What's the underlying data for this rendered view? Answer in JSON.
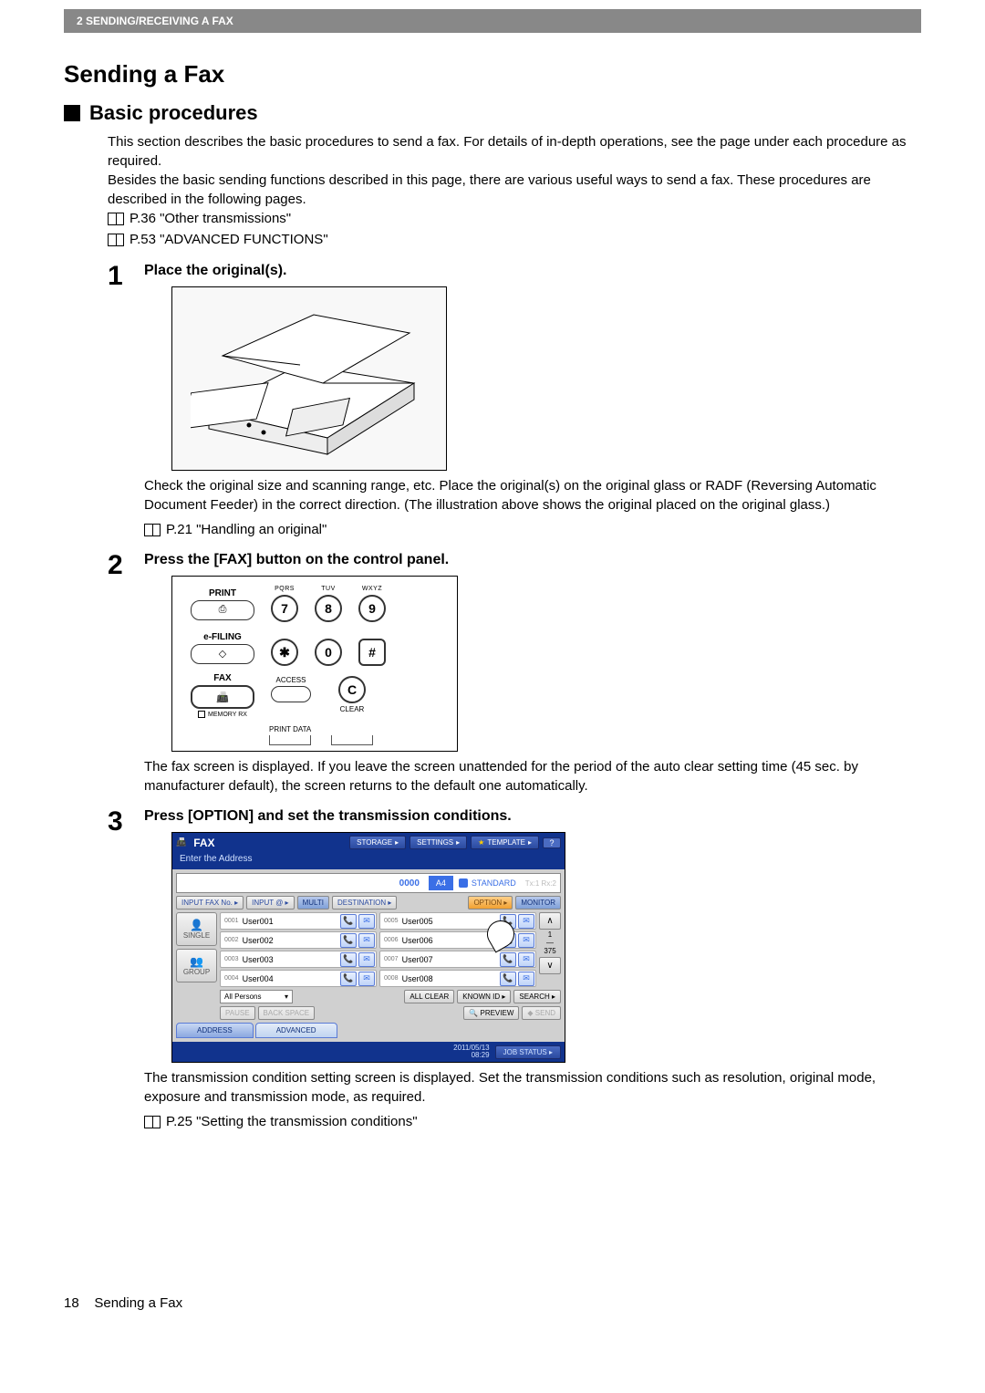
{
  "header": {
    "chapter": "2 SENDING/RECEIVING A FAX"
  },
  "h1": "Sending a Fax",
  "h2": "Basic procedures",
  "intro1": "This section describes the basic procedures to send a fax. For details of in-depth operations, see the page under each procedure as required.",
  "intro2": "Besides the basic sending functions described in this page, there are various useful ways to send a fax. These procedures are described in the following pages.",
  "ref1": "P.36 \"Other transmissions\"",
  "ref2": "P.53 \"ADVANCED FUNCTIONS\"",
  "steps": {
    "s1": {
      "num": "1",
      "title": "Place the original(s).",
      "text": "Check the original size and scanning range, etc. Place the original(s) on the original glass or RADF (Reversing Automatic Document Feeder) in the correct direction. (The illustration above shows the original placed on the original glass.)",
      "ref": "P.21 \"Handling an original\""
    },
    "s2": {
      "num": "2",
      "title": "Press the [FAX] button on the control panel.",
      "text": "The fax screen is displayed. If you leave the screen unattended for the period of the auto clear setting time (45 sec. by manufacturer default), the screen returns to the default one automatically."
    },
    "s3": {
      "num": "3",
      "title": "Press [OPTION] and set the transmission conditions.",
      "text": "The transmission condition setting screen is displayed. Set the transmission conditions such as resolution, original mode, exposure and transmission mode, as required.",
      "ref": "P.25 \"Setting the transmission conditions\""
    }
  },
  "panel": {
    "print": "PRINT",
    "efiling": "e-FILING",
    "fax": "FAX",
    "memoryrx": "MEMORY RX",
    "access": "ACCESS",
    "clear": "CLEAR",
    "printdata": "PRINT DATA",
    "pqrs": "PQRS",
    "tuv": "TUV",
    "wxyz": "WXYZ",
    "k7": "7",
    "k8": "8",
    "k9": "9",
    "kast": "✱",
    "k0": "0",
    "khash": "#",
    "kc": "C"
  },
  "fax": {
    "title": "FAX",
    "storage": "STORAGE",
    "settings": "SETTINGS",
    "template": "TEMPLATE",
    "help": "?",
    "subtitle": "Enter the Address",
    "count": "0000",
    "a4": "A4",
    "standard": "STANDARD",
    "txrx": "Tx:1  Rx:2",
    "inputfax": "INPUT FAX No.",
    "inputat": "INPUT @",
    "multi": "MULTI",
    "destination": "DESTINATION",
    "option": "OPTION",
    "monitor": "MONITOR",
    "single": "SINGLE",
    "group": "GROUP",
    "rows": [
      {
        "n": "0001",
        "nm": "User001"
      },
      {
        "n": "0002",
        "nm": "User002"
      },
      {
        "n": "0003",
        "nm": "User003"
      },
      {
        "n": "0004",
        "nm": "User004"
      },
      {
        "n": "0005",
        "nm": "User005"
      },
      {
        "n": "0006",
        "nm": "User006"
      },
      {
        "n": "0007",
        "nm": "User007"
      },
      {
        "n": "0008",
        "nm": "User008"
      }
    ],
    "page1": "1",
    "pageN": "375",
    "allpersons": "All Persons",
    "allclear": "ALL CLEAR",
    "knownid": "KNOWN ID",
    "search": "SEARCH",
    "pause": "PAUSE",
    "backspace": "BACK SPACE",
    "preview": "PREVIEW",
    "send": "SEND",
    "tab_address": "ADDRESS",
    "tab_advanced": "ADVANCED",
    "datetime": "2011/05/13\n08:29",
    "jobstatus": "JOB STATUS"
  },
  "footer": {
    "page": "18",
    "label": "Sending a Fax"
  }
}
